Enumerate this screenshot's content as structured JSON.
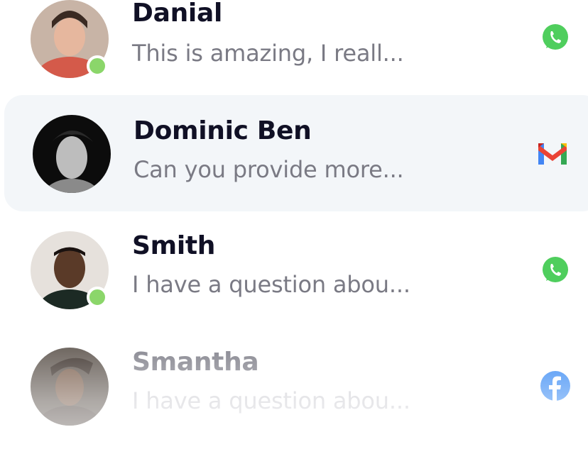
{
  "conversations": [
    {
      "name": "Danial",
      "preview": "This is amazing, I reall...",
      "channel": "whatsapp-icon",
      "online": true
    },
    {
      "name": "Dominic Ben",
      "preview": "Can you provide more...",
      "channel": "gmail-icon",
      "online": false,
      "selected": true
    },
    {
      "name": "Smith",
      "preview": "I have a question abou...",
      "channel": "whatsapp-icon",
      "online": true
    },
    {
      "name": "Smantha",
      "preview": "I have a question abou...",
      "channel": "facebook-icon",
      "online": false
    }
  ],
  "colors": {
    "online": "#8bd66a",
    "whatsapp": "#4fce5d",
    "facebook": "#1877f2",
    "selected_row": "#f3f6f9"
  }
}
